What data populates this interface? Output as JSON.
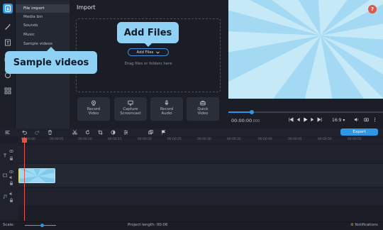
{
  "sidebar": {
    "icons": [
      "import-icon",
      "magic-wand-icon",
      "titles-icon",
      "transitions-icon",
      "stickers-icon",
      "more-tools-icon"
    ],
    "categories": [
      "File import",
      "Media bin",
      "Sounds",
      "Music",
      "Sample videos"
    ],
    "selected": "File import"
  },
  "import_panel": {
    "title": "Import",
    "add_files_label": "Add Files",
    "drop_text": "Drag files or folders here",
    "record_buttons": [
      {
        "icon": "webcam-icon",
        "label": "Record\nVideo"
      },
      {
        "icon": "screen-icon",
        "label": "Capture\nScreencast"
      },
      {
        "icon": "microphone-icon",
        "label": "Record\nAudio"
      },
      {
        "icon": "briefcase-icon",
        "label": "Quick\nVideo"
      }
    ]
  },
  "callouts": {
    "add_files": "Add Files",
    "sample_videos": "Sample videos"
  },
  "preview": {
    "timecode": "00:00:00",
    "timecode_ms": ".000",
    "aspect_ratio": "16:9",
    "help": "?",
    "playback_progress": 0.16
  },
  "toolbar": {
    "export_label": "Export"
  },
  "timeline": {
    "ruler_ticks": [
      "00:00:00",
      "00:00:05",
      "00:00:10",
      "00:00:15",
      "00:00:20",
      "00:00:25",
      "00:00:30",
      "00:00:35",
      "00:00:40",
      "00:00:45",
      "00:00:50",
      "00:00:55"
    ]
  },
  "status": {
    "scale_label": "Scale:",
    "project_length_label": "Project length:",
    "project_length_value": "00:06",
    "notifications_label": "Notifications"
  },
  "colors": {
    "accent": "#2e97e6",
    "callout": "#8fd0f5",
    "clip_border": "#f1e06a",
    "playhead": "#e2574c"
  }
}
